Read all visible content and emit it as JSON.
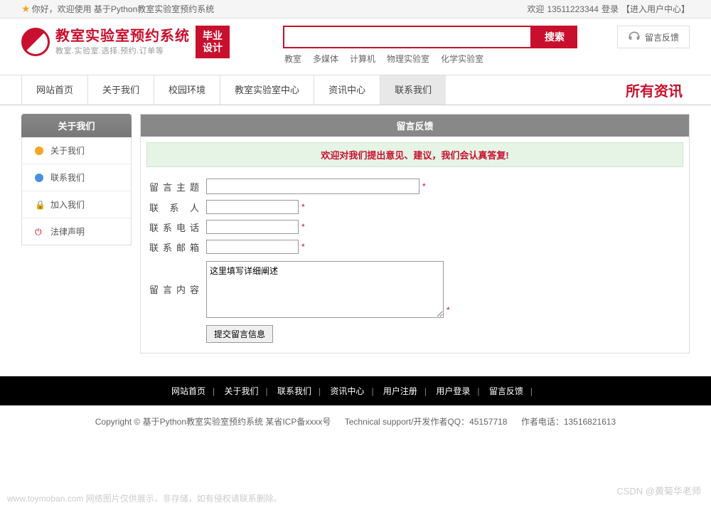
{
  "topbar": {
    "greeting": "你好，欢迎使用 基于Python教室实验室预约系统",
    "welcome": "欢迎",
    "phone": "13511223344",
    "login": "登录",
    "user_center": "【进入用户中心】"
  },
  "header": {
    "title": "教室实验室预约系统",
    "subtitle": "教室.实验室.选择.预约.订单等",
    "badge_line1": "毕业",
    "badge_line2": "设计",
    "search_button": "搜索",
    "categories": [
      "教室",
      "多媒体",
      "计算机",
      "物理实验室",
      "化学实验室"
    ],
    "feedback_label": "留言反馈"
  },
  "nav": {
    "items": [
      "网站首页",
      "关于我们",
      "校园环境",
      "教室实验室中心",
      "资讯中心",
      "联系我们"
    ],
    "right": "所有资讯"
  },
  "sidebar": {
    "title": "关于我们",
    "items": [
      {
        "label": "关于我们",
        "icon": "orange"
      },
      {
        "label": "联系我们",
        "icon": "blue"
      },
      {
        "label": "加入我们",
        "icon": "pink"
      },
      {
        "label": "法律声明",
        "icon": "red"
      }
    ]
  },
  "content": {
    "title": "留言反馈",
    "welcome_msg": "欢迎对我们提出意见、建议，我们会认真答复!",
    "labels": {
      "subject": "留言主题",
      "contact": "联 系 人",
      "phone": "联系电话",
      "email": "联系邮箱",
      "body": "留言内容"
    },
    "textarea_value": "这里填写详细阐述",
    "submit": "提交留言信息"
  },
  "footer": {
    "nav": [
      "网站首页",
      "关于我们",
      "联系我们",
      "资讯中心",
      "用户注册",
      "用户登录",
      "留言反馈"
    ],
    "copyright": "Copyright © 基于Python教室实验室预约系统 某省ICP备xxxx号",
    "tech": "Technical support/开发作者QQ：45157718",
    "author_phone": "作者电话：13516821613"
  },
  "watermark": {
    "left": "www.toymoban.com 网络图片仅供展示，非存储，如有侵权请联系删除。",
    "right": "CSDN @黄菊华老师"
  }
}
